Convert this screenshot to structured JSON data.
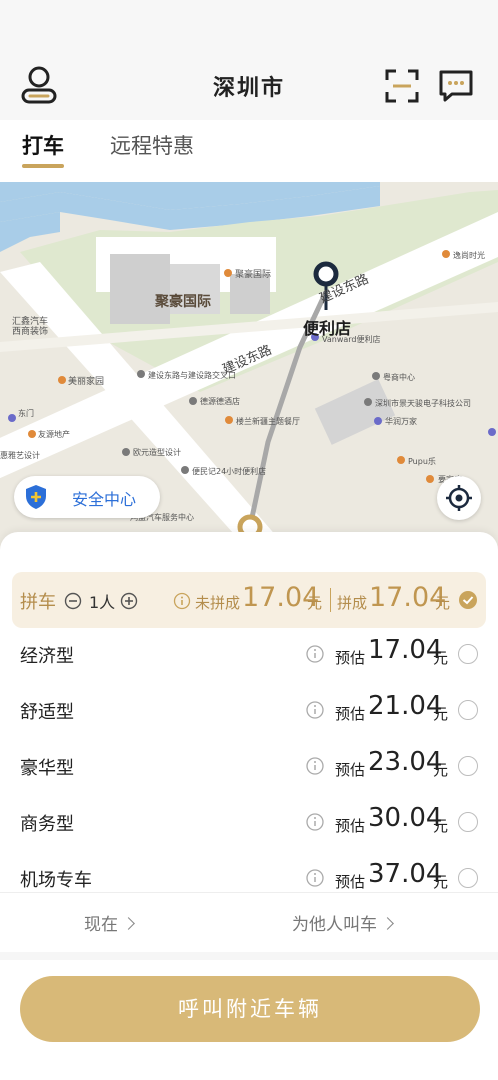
{
  "header": {
    "city": "深圳市",
    "icons": {
      "left": "user-icon",
      "scan": "scan-icon",
      "message": "message-icon"
    }
  },
  "tabs": [
    {
      "label": "打车",
      "active": true
    },
    {
      "label": "远程特惠",
      "active": false
    }
  ],
  "map": {
    "labels": {
      "juhao_main": "聚豪国际",
      "juhao_small": "聚豪国际",
      "road_1": "建设东路",
      "road_2": "建设东路",
      "store": "便利店",
      "store_vanward": "Vanward便利店",
      "huizhan": "汇鑫汽车",
      "huizhan2": "西商装饰",
      "meili": "美丽家园",
      "jianshe_community": "建设东路与建设路交叉口",
      "jiangyuan": "德源德酒店",
      "louwu": "楼兰新疆主题餐厅",
      "ouyuan": "欧元造型设计",
      "yue": "粤商中心",
      "jingyu": "深圳市景天骏电子科技公司",
      "huarun": "华润万家",
      "pupu": "Pupu乐",
      "yijia": "逸尚时光",
      "dongmen": "东门",
      "youyuan": "友源地产",
      "chaoyi": "惠雅艺设计",
      "store24": "便民记24小时便利店",
      "carservice": "鸿盛汽车服务中心",
      "yaojia": "要家店"
    },
    "accent_route": "#a8a8a8",
    "pin_color": "#1c2a3e"
  },
  "safety_center": {
    "label": "安全中心",
    "icon": "shield-plus-icon",
    "color": "#2c6fd8"
  },
  "locate_icon": "crosshair-icon",
  "carpool": {
    "title": "拼车",
    "count": "1人",
    "not_pooled_label": "未拼成",
    "not_pooled_price": "17.04",
    "pooled_label": "拼成",
    "pooled_price": "17.04",
    "unit": "元",
    "selected": true
  },
  "ride_options": [
    {
      "name": "经济型",
      "prefix": "预估",
      "price": "17.04",
      "unit": "元"
    },
    {
      "name": "舒适型",
      "prefix": "预估",
      "price": "21.04",
      "unit": "元"
    },
    {
      "name": "豪华型",
      "prefix": "预估",
      "price": "23.04",
      "unit": "元"
    },
    {
      "name": "商务型",
      "prefix": "预估",
      "price": "30.04",
      "unit": "元"
    },
    {
      "name": "机场专车",
      "prefix": "预估",
      "price": "37.04",
      "unit": "元"
    }
  ],
  "options_bar": {
    "now": "现在",
    "for_other": "为他人叫车"
  },
  "call_button": "呼叫附近车辆",
  "colors": {
    "gold": "#c9a45c",
    "button": "#d8b978",
    "carpool_bg": "#f7efe1"
  }
}
